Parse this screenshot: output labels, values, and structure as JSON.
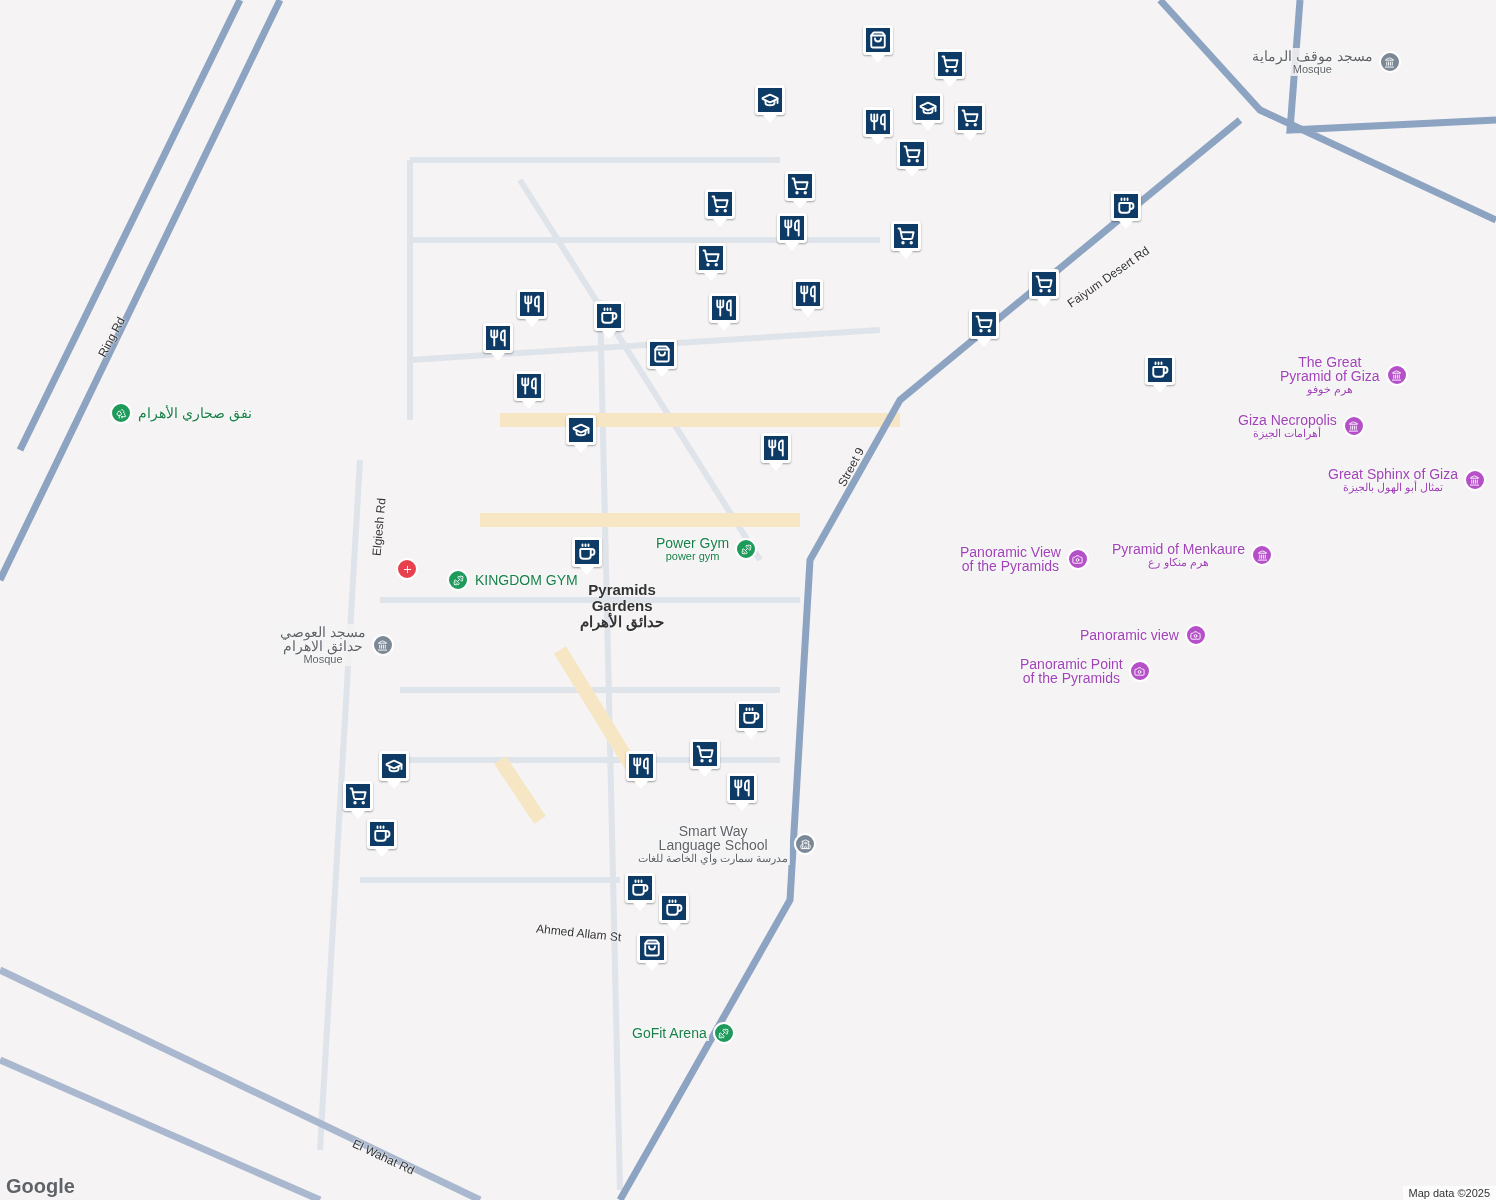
{
  "markers": [
    {
      "kind": "bag"
    },
    {
      "kind": "school"
    },
    {
      "kind": "cart"
    },
    {
      "kind": "school"
    },
    {
      "kind": "cart"
    },
    {
      "kind": "food"
    },
    {
      "kind": "cart"
    },
    {
      "kind": "cart"
    },
    {
      "kind": "cart"
    },
    {
      "kind": "food"
    },
    {
      "kind": "cart"
    },
    {
      "kind": "cart"
    },
    {
      "kind": "cart"
    },
    {
      "kind": "cart"
    },
    {
      "kind": "food"
    },
    {
      "kind": "food"
    },
    {
      "kind": "cafe"
    },
    {
      "kind": "cafe"
    },
    {
      "kind": "food"
    },
    {
      "kind": "bag"
    },
    {
      "kind": "food"
    },
    {
      "kind": "food"
    },
    {
      "kind": "cafe"
    },
    {
      "kind": "school"
    },
    {
      "kind": "food"
    },
    {
      "kind": "cafe"
    },
    {
      "kind": "cafe"
    },
    {
      "kind": "food"
    },
    {
      "kind": "cart"
    },
    {
      "kind": "food"
    },
    {
      "kind": "school"
    },
    {
      "kind": "cart"
    },
    {
      "kind": "cafe"
    },
    {
      "kind": "cafe"
    },
    {
      "kind": "cafe"
    },
    {
      "kind": "bag"
    }
  ],
  "places": [
    {
      "kind": "mosque",
      "lines": [
        "مسجد موقف الرماية"
      ],
      "sub": "Mosque"
    },
    {
      "kind": "museum",
      "lines": [
        "The Great",
        "Pyramid of Giza"
      ],
      "sub": "هرم خوفو"
    },
    {
      "kind": "park",
      "lines": [
        "نفق صحاري الأهرام"
      ]
    },
    {
      "kind": "museum",
      "lines": [
        "Giza Necropolis"
      ],
      "sub": "أهرامات الجيزة"
    },
    {
      "kind": "museum",
      "lines": [
        "Great Sphinx of Giza"
      ],
      "sub": "تمثال أبو الهول بالجيزة"
    },
    {
      "kind": "gym",
      "lines": [
        "Power Gym"
      ],
      "sub": "power gym"
    },
    {
      "kind": "camera",
      "lines": [
        "Panoramic View",
        "of the Pyramids"
      ]
    },
    {
      "kind": "museum",
      "lines": [
        "Pyramid of Menkaure"
      ],
      "sub": "هرم منكاو رع"
    },
    {
      "kind": "hospital"
    },
    {
      "kind": "gym",
      "lines": [
        "KINGDOM GYM"
      ]
    },
    {
      "kind": "mosque",
      "lines": [
        "مسجد العوصي",
        "حدائق الاهرام"
      ],
      "sub": "Mosque"
    },
    {
      "kind": "camera",
      "lines": [
        "Panoramic view"
      ]
    },
    {
      "kind": "camera",
      "lines": [
        "Panoramic Point",
        "of the Pyramids"
      ]
    },
    {
      "kind": "school",
      "lines": [
        "Smart Way",
        "Language School"
      ],
      "sub": "مدرسة سمارت واي الخاصة للغات"
    },
    {
      "kind": "gym",
      "lines": [
        "GoFit Arena"
      ]
    }
  ],
  "areas": [
    {
      "lines": [
        "Pyramids",
        "Gardens",
        "حدائق الأهرام"
      ]
    }
  ],
  "roads": [
    {
      "label": "Ring Rd"
    },
    {
      "label": "Faiyum Desert Rd"
    },
    {
      "label": "Street 9"
    },
    {
      "label": "Ahmed Allam St"
    },
    {
      "label": "El Wahat Rd"
    },
    {
      "label": "Elgiesh Rd"
    }
  ],
  "attribution": {
    "logo": "Google",
    "text": "Map data ©2025"
  }
}
